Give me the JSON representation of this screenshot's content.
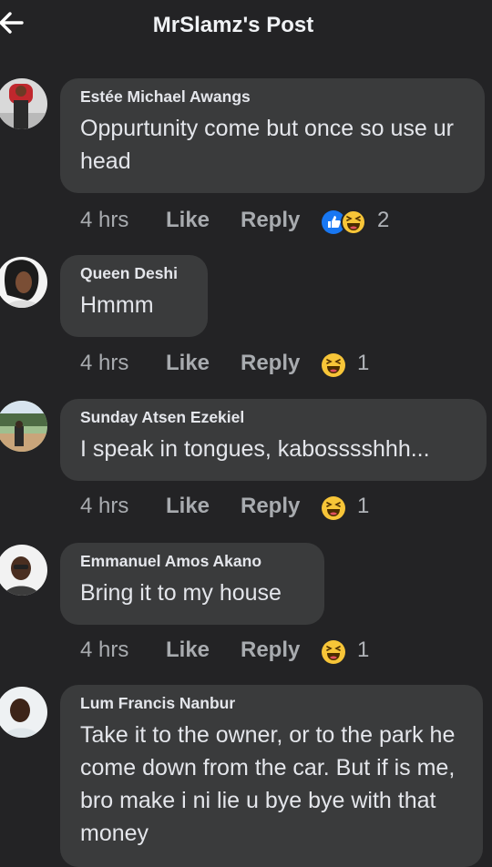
{
  "header": {
    "title": "MrSlamz's Post",
    "back_icon": "arrow-left-icon"
  },
  "colors": {
    "background": "#232325",
    "bubble": "#3a3b3c",
    "like_blue": "#1877f2",
    "haha_yellow": "#f7c538"
  },
  "comments": [
    {
      "author": "Estée Michael Awangs",
      "text": "Oppurtunity come but once so use ur head",
      "time": "4 hrs",
      "like": "Like",
      "reply": "Reply",
      "reactions": [
        "like-reaction-icon",
        "haha-reaction-icon"
      ],
      "count": "2"
    },
    {
      "author": "Queen Deshi",
      "text": "Hmmm",
      "time": "4 hrs",
      "like": "Like",
      "reply": "Reply",
      "reactions": [
        "haha-reaction-icon"
      ],
      "count": "1"
    },
    {
      "author": "Sunday Atsen Ezekiel",
      "text": "I speak in tongues, kabosssshhh...",
      "time": "4 hrs",
      "like": "Like",
      "reply": "Reply",
      "reactions": [
        "haha-reaction-icon"
      ],
      "count": "1"
    },
    {
      "author": "Emmanuel Amos Akano",
      "text": "Bring it to my house",
      "time": "4 hrs",
      "like": "Like",
      "reply": "Reply",
      "reactions": [
        "haha-reaction-icon"
      ],
      "count": "1"
    },
    {
      "author": "Lum Francis Nanbur",
      "text": "Take it to the owner, or to the park he come down from the car. But if is me, bro make i ni lie u bye bye with that money"
    }
  ]
}
